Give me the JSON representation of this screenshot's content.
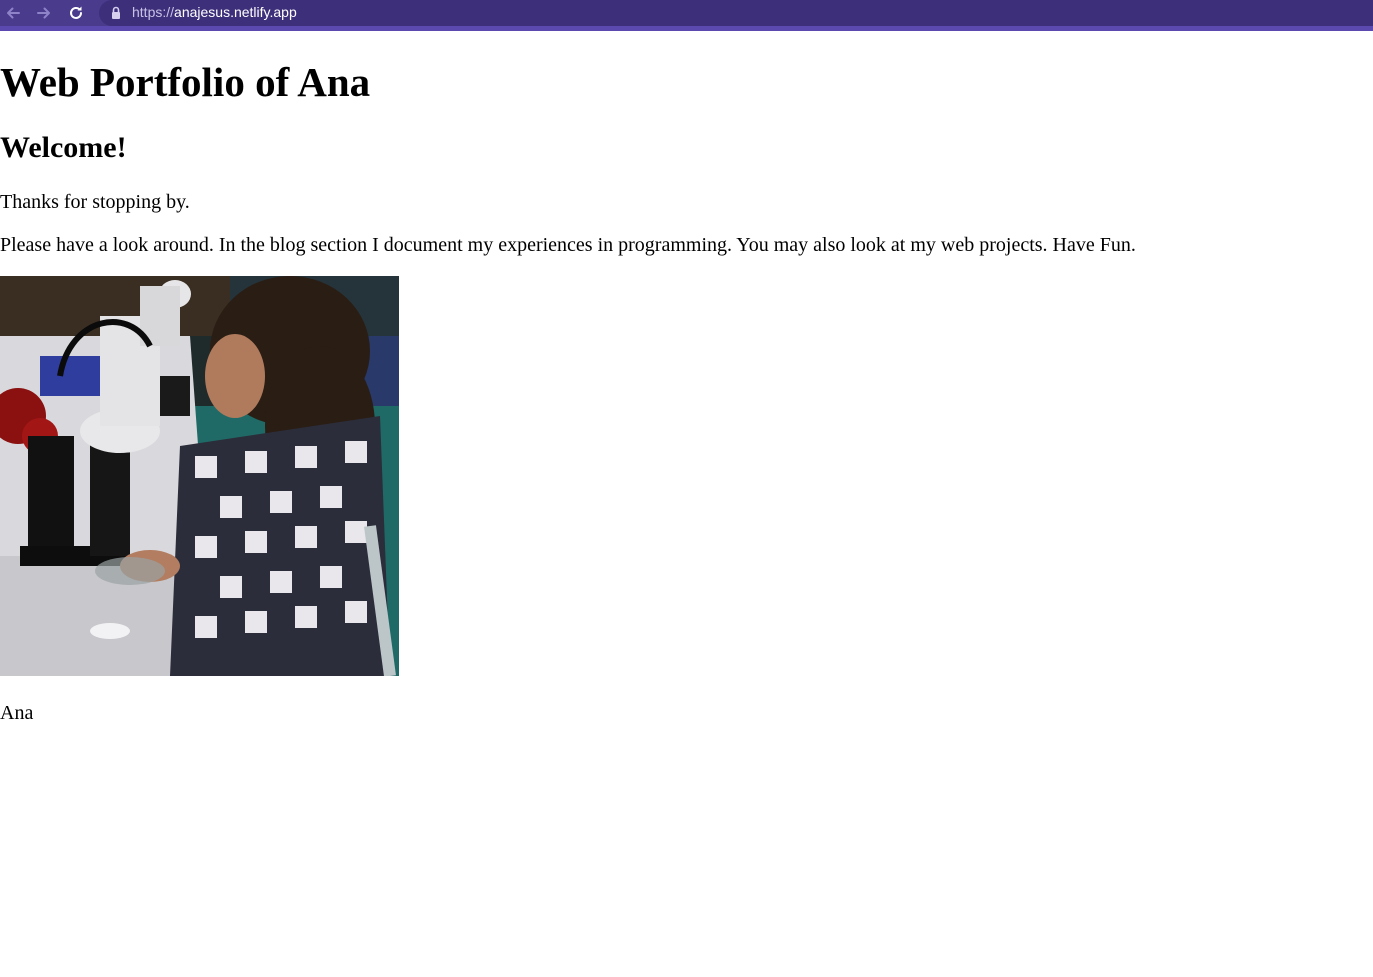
{
  "browser": {
    "url_scheme": "https://",
    "url_host": "anajesus.netlify.app",
    "icons": {
      "back": "arrow-left-icon",
      "forward": "arrow-right-icon",
      "reload": "reload-icon",
      "lock": "lock-icon"
    },
    "colors": {
      "toolbar": "#4a3b8c",
      "accent": "#5b49b0"
    }
  },
  "page": {
    "title": "Web Portfolio of Ana",
    "heading": "Welcome!",
    "intro": "Thanks for stopping by.",
    "body": "Please have a look around. In the blog section I document my experiences in programming. You may also look at my web projects. Have Fun.",
    "photo_alt": "Ana at a stereo microscope",
    "caption": "Ana"
  }
}
